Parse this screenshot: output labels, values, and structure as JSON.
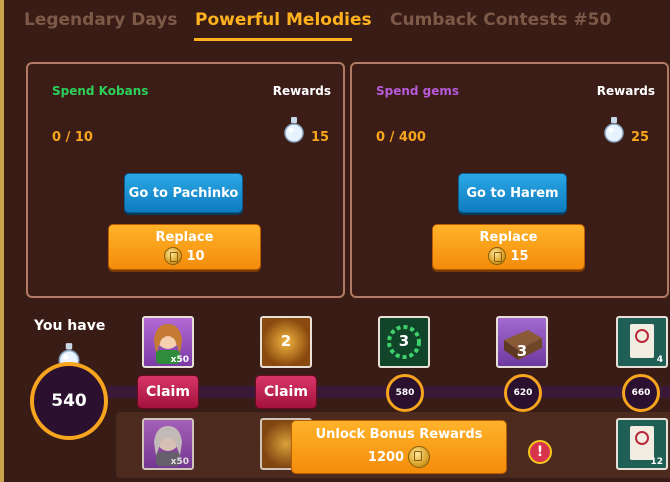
{
  "tabs": [
    {
      "label": "Legendary Days",
      "active": false
    },
    {
      "label": "Powerful Melodies",
      "active": true
    },
    {
      "label": "Cumback Contests #50",
      "active": false
    }
  ],
  "tasks": [
    {
      "title": "Spend Kobans",
      "title_color": "#2bd15a",
      "rewards_label": "Rewards",
      "progress": "0 / 10",
      "reward_amount": "15",
      "action_label": "Go to Pachinko",
      "replace_label": "Replace",
      "replace_cost": "10"
    },
    {
      "title": "Spend gems",
      "title_color": "#b75bd8",
      "rewards_label": "Rewards",
      "progress": "0 / 400",
      "reward_amount": "25",
      "action_label": "Go to Harem",
      "replace_label": "Replace",
      "replace_cost": "15"
    }
  ],
  "balance": {
    "label": "You have",
    "value": "540"
  },
  "milestones": [
    {
      "claim_label": "Claim",
      "top_reward": {
        "type": "girl-card",
        "count": "x50"
      },
      "bonus_reward": {
        "type": "girl-card",
        "count": "x50"
      }
    },
    {
      "claim_label": "Claim",
      "top_reward": {
        "type": "orb",
        "count": "2"
      },
      "bonus_reward": {
        "type": "orb",
        "count": ""
      }
    },
    {
      "threshold": "580",
      "top_reward": {
        "type": "green-gems",
        "count": "3"
      }
    },
    {
      "threshold": "620",
      "top_reward": {
        "type": "chest",
        "count": "3"
      }
    },
    {
      "threshold": "660",
      "top_reward": {
        "type": "ticket",
        "count": "4"
      },
      "bonus_reward": {
        "type": "ticket",
        "count": "12"
      }
    }
  ],
  "unlock": {
    "label": "Unlock Bonus Rewards",
    "cost": "1200"
  },
  "colors": {
    "accent": "#ffb21e",
    "orange_button": "#f7a51e",
    "blue_button": "#1a90d4",
    "claim_button": "#c22456",
    "background": "#3a1c16"
  }
}
